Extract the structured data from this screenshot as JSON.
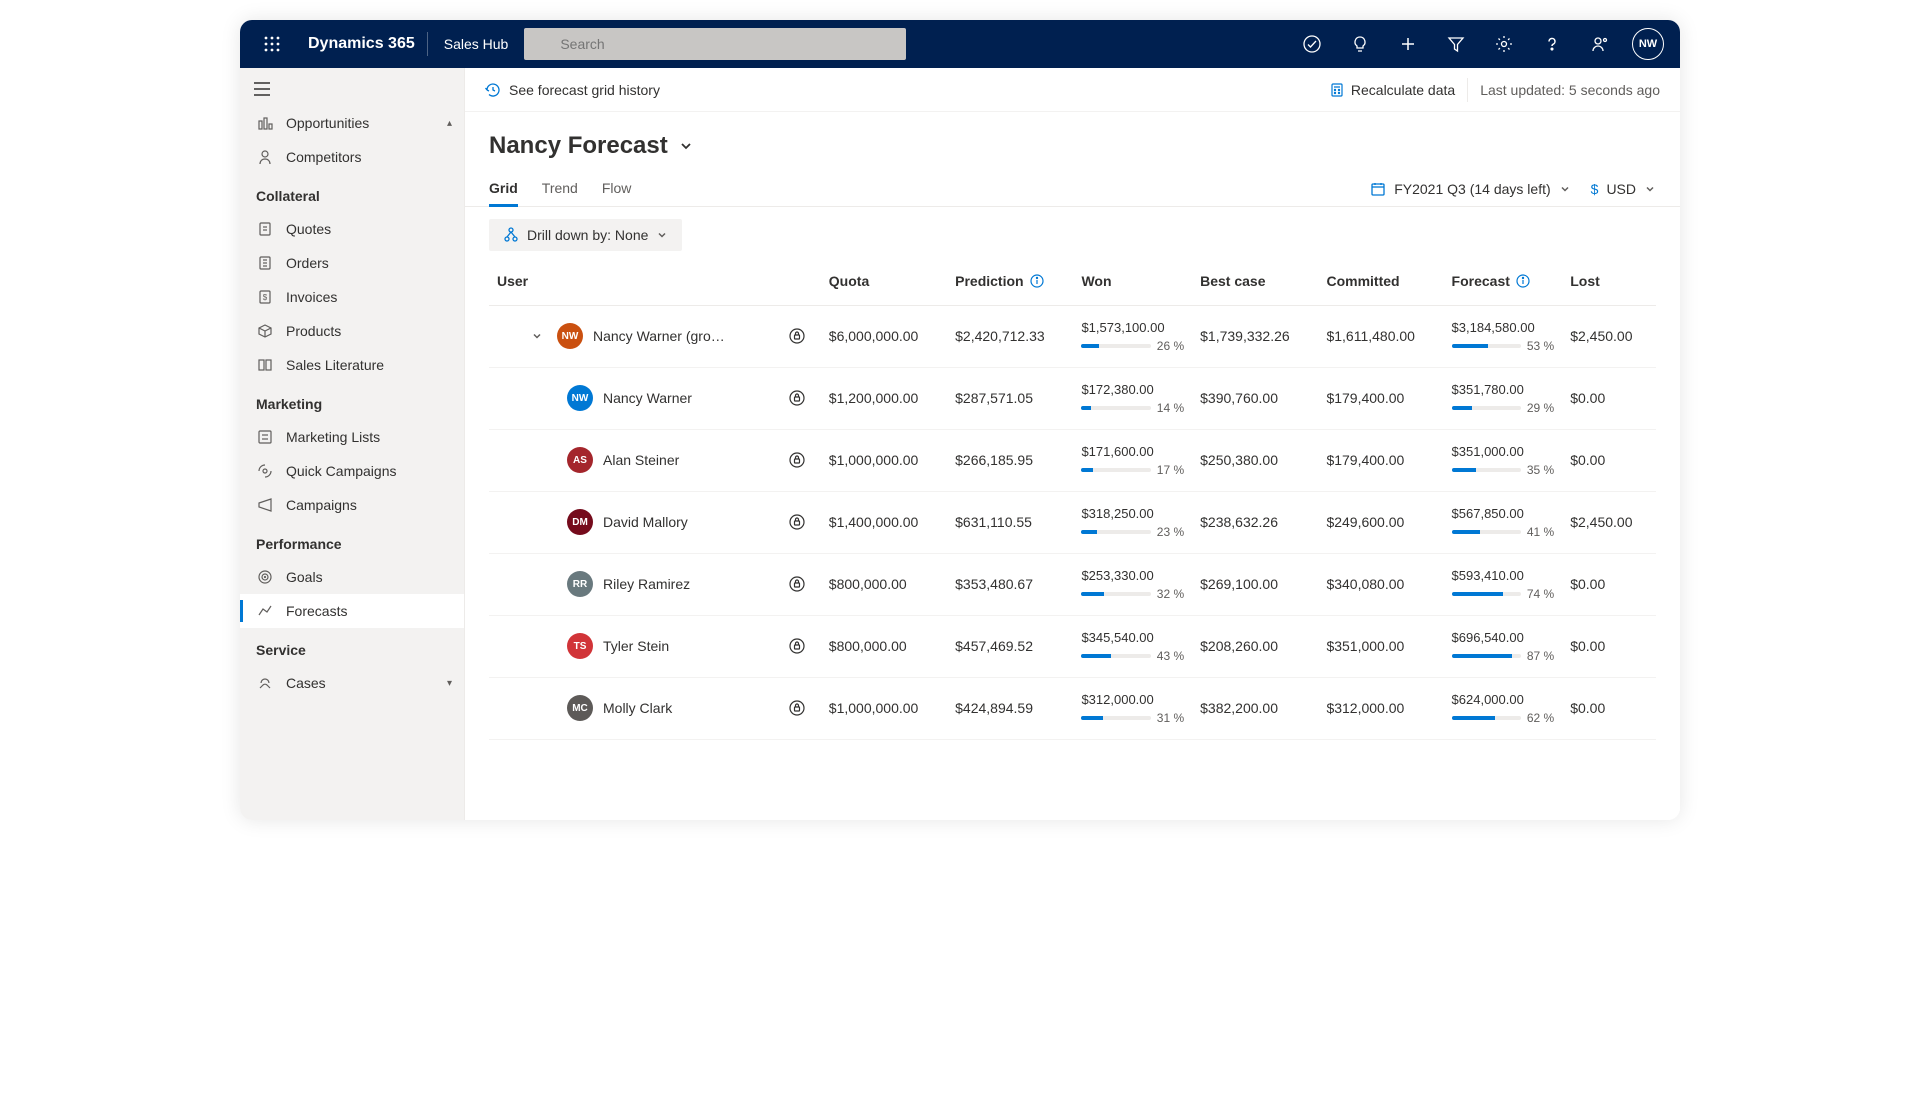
{
  "topbar": {
    "brand": "Dynamics 365",
    "appname": "Sales Hub",
    "search_placeholder": "Search",
    "avatar_initials": "NW"
  },
  "sidebar": {
    "items_top": [
      {
        "label": "Opportunities",
        "icon": "opportunities"
      },
      {
        "label": "Competitors",
        "icon": "competitors"
      }
    ],
    "section_collateral": "Collateral",
    "items_collateral": [
      {
        "label": "Quotes",
        "icon": "quotes"
      },
      {
        "label": "Orders",
        "icon": "orders"
      },
      {
        "label": "Invoices",
        "icon": "invoices"
      },
      {
        "label": "Products",
        "icon": "products"
      },
      {
        "label": "Sales Literature",
        "icon": "literature"
      }
    ],
    "section_marketing": "Marketing",
    "items_marketing": [
      {
        "label": "Marketing Lists",
        "icon": "marketing-lists"
      },
      {
        "label": "Quick Campaigns",
        "icon": "quick-campaigns"
      },
      {
        "label": "Campaigns",
        "icon": "campaigns"
      }
    ],
    "section_performance": "Performance",
    "items_performance": [
      {
        "label": "Goals",
        "icon": "goals"
      },
      {
        "label": "Forecasts",
        "icon": "forecasts"
      }
    ],
    "section_service": "Service",
    "items_service": [
      {
        "label": "Cases",
        "icon": "cases"
      }
    ],
    "active": "Forecasts"
  },
  "cmdbar": {
    "history_label": "See forecast grid history",
    "recalc_label": "Recalculate data",
    "last_updated": "Last updated: 5 seconds ago"
  },
  "page": {
    "title": "Nancy Forecast",
    "tabs": [
      "Grid",
      "Trend",
      "Flow"
    ],
    "active_tab": "Grid",
    "period_label": "FY2021 Q3 (14 days left)",
    "currency_label": "USD",
    "drilldown_label": "Drill down by: None"
  },
  "table": {
    "columns": [
      "User",
      "Quota",
      "Prediction",
      "Won",
      "Best case",
      "Committed",
      "Forecast",
      "Lost"
    ],
    "rows": [
      {
        "user": "Nancy Warner (gro…",
        "initials": "NW",
        "avatar_class": "bg-orange",
        "indent": 0,
        "expandable": true,
        "quota": "$6,000,000.00",
        "prediction": "$2,420,712.33",
        "won_value": "$1,573,100.00",
        "won_pct": "26 %",
        "won_fill": 26,
        "bestcase": "$1,739,332.26",
        "committed": "$1,611,480.00",
        "forecast_value": "$3,184,580.00",
        "forecast_pct": "53 %",
        "forecast_fill": 53,
        "lost": "$2,450.00"
      },
      {
        "user": "Nancy Warner",
        "initials": "NW",
        "avatar_class": "bg-blue",
        "indent": 1,
        "quota": "$1,200,000.00",
        "prediction": "$287,571.05",
        "won_value": "$172,380.00",
        "won_pct": "14 %",
        "won_fill": 14,
        "bestcase": "$390,760.00",
        "committed": "$179,400.00",
        "forecast_value": "$351,780.00",
        "forecast_pct": "29 %",
        "forecast_fill": 29,
        "lost": "$0.00"
      },
      {
        "user": "Alan Steiner",
        "initials": "AS",
        "avatar_class": "bg-red",
        "indent": 1,
        "quota": "$1,000,000.00",
        "prediction": "$266,185.95",
        "won_value": "$171,600.00",
        "won_pct": "17 %",
        "won_fill": 17,
        "bestcase": "$250,380.00",
        "committed": "$179,400.00",
        "forecast_value": "$351,000.00",
        "forecast_pct": "35 %",
        "forecast_fill": 35,
        "lost": "$0.00"
      },
      {
        "user": "David Mallory",
        "initials": "DM",
        "avatar_class": "bg-maroon",
        "indent": 1,
        "quota": "$1,400,000.00",
        "prediction": "$631,110.55",
        "won_value": "$318,250.00",
        "won_pct": "23 %",
        "won_fill": 23,
        "bestcase": "$238,632.26",
        "committed": "$249,600.00",
        "forecast_value": "$567,850.00",
        "forecast_pct": "41 %",
        "forecast_fill": 41,
        "lost": "$2,450.00"
      },
      {
        "user": "Riley Ramirez",
        "initials": "RR",
        "avatar_class": "bg-gray",
        "indent": 1,
        "quota": "$800,000.00",
        "prediction": "$353,480.67",
        "won_value": "$253,330.00",
        "won_pct": "32 %",
        "won_fill": 32,
        "bestcase": "$269,100.00",
        "committed": "$340,080.00",
        "forecast_value": "$593,410.00",
        "forecast_pct": "74 %",
        "forecast_fill": 74,
        "lost": "$0.00"
      },
      {
        "user": "Tyler Stein",
        "initials": "TS",
        "avatar_class": "bg-tomato",
        "indent": 1,
        "quota": "$800,000.00",
        "prediction": "$457,469.52",
        "won_value": "$345,540.00",
        "won_pct": "43 %",
        "won_fill": 43,
        "bestcase": "$208,260.00",
        "committed": "$351,000.00",
        "forecast_value": "$696,540.00",
        "forecast_pct": "87 %",
        "forecast_fill": 87,
        "lost": "$0.00"
      },
      {
        "user": "Molly Clark",
        "initials": "MC",
        "avatar_class": "bg-darkgray",
        "indent": 1,
        "quota": "$1,000,000.00",
        "prediction": "$424,894.59",
        "won_value": "$312,000.00",
        "won_pct": "31 %",
        "won_fill": 31,
        "bestcase": "$382,200.00",
        "committed": "$312,000.00",
        "forecast_value": "$624,000.00",
        "forecast_pct": "62 %",
        "forecast_fill": 62,
        "lost": "$0.00"
      }
    ]
  }
}
